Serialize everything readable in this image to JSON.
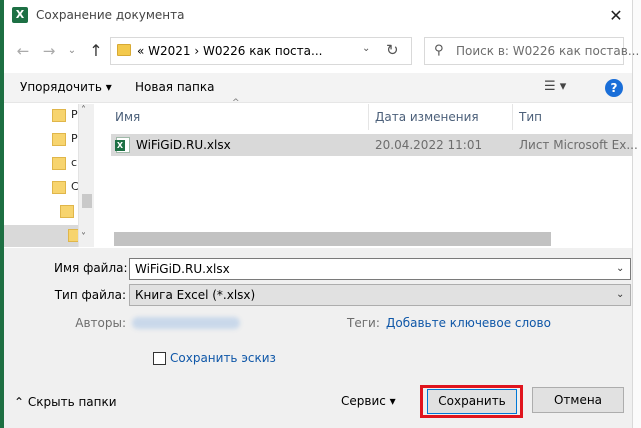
{
  "window": {
    "title": "Сохранение документа",
    "app_icon_letter": "X",
    "close_glyph": "✕"
  },
  "nav": {
    "back_glyph": "←",
    "forward_glyph": "→",
    "dropdown_glyph": "⌄",
    "up_glyph": "↑"
  },
  "address": {
    "path": "«  W2021  ›  W0226 как поста...",
    "dropdown_glyph": "⌄",
    "refresh_glyph": "↻"
  },
  "search": {
    "placeholder": "Поиск в: W0226 как постав..."
  },
  "toolbar": {
    "organize_label": "Упорядочить ▾",
    "new_folder_label": "Новая папка",
    "view_glyph": "☰ ▾",
    "help_glyph": "?"
  },
  "navpane": {
    "items": [
      {
        "letter": "P"
      },
      {
        "letter": "P"
      },
      {
        "letter": "c"
      },
      {
        "letter": "C"
      }
    ],
    "scroll_up_glyph": "˄",
    "scroll_down_glyph": "˅"
  },
  "filelist": {
    "sort_glyph": "^",
    "columns": [
      "Имя",
      "Дата изменения",
      "Тип"
    ],
    "rows": [
      {
        "name": "WiFiGiD.RU.xlsx",
        "modified": "20.04.2022 11:01",
        "type": "Лист Microsoft Ex..."
      }
    ]
  },
  "form": {
    "filename_label": "Имя файла:",
    "filename_value": "WiFiGiD.RU.xlsx",
    "filetype_label": "Тип файла:",
    "filetype_value": "Книга Excel (*.xlsx)",
    "authors_label": "Авторы:",
    "tags_label": "Теги:",
    "tags_value": "Добавьте ключевое слово",
    "thumbnail_label": "Сохранить эскиз",
    "thumbnail_checked": false,
    "dropdown_glyph": "⌄"
  },
  "footer": {
    "hide_folders_label": "⌃  Скрыть папки",
    "service_label": "Сервис   ▾",
    "save_label": "Сохранить",
    "cancel_label": "Отмена",
    "highlight_color": "#e0151e"
  }
}
